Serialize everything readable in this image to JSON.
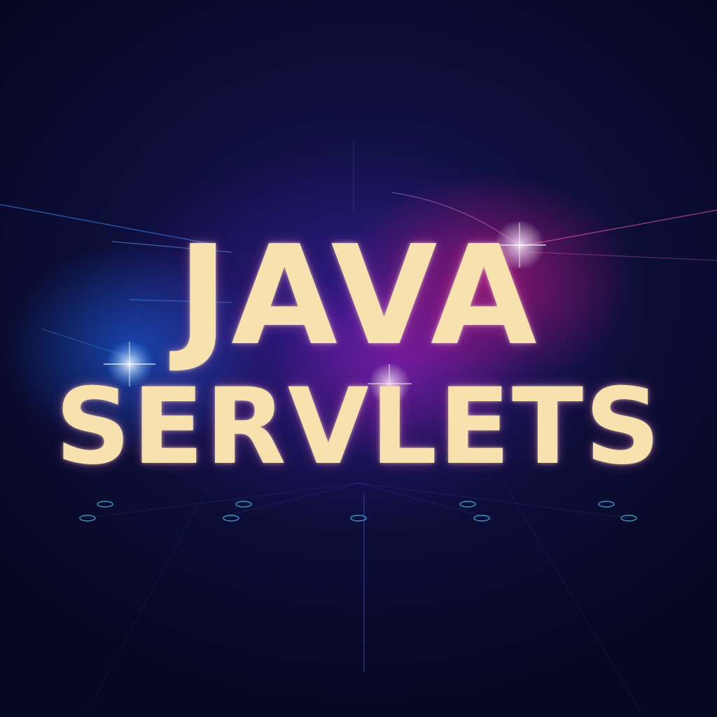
{
  "title": {
    "line1": "JAVA",
    "line2": "SERVLETS"
  },
  "colors": {
    "text": "#f7e2ae",
    "glow_pink": "#e6148c",
    "glow_blue": "#1e6eff",
    "background": "#0e0f3e"
  }
}
